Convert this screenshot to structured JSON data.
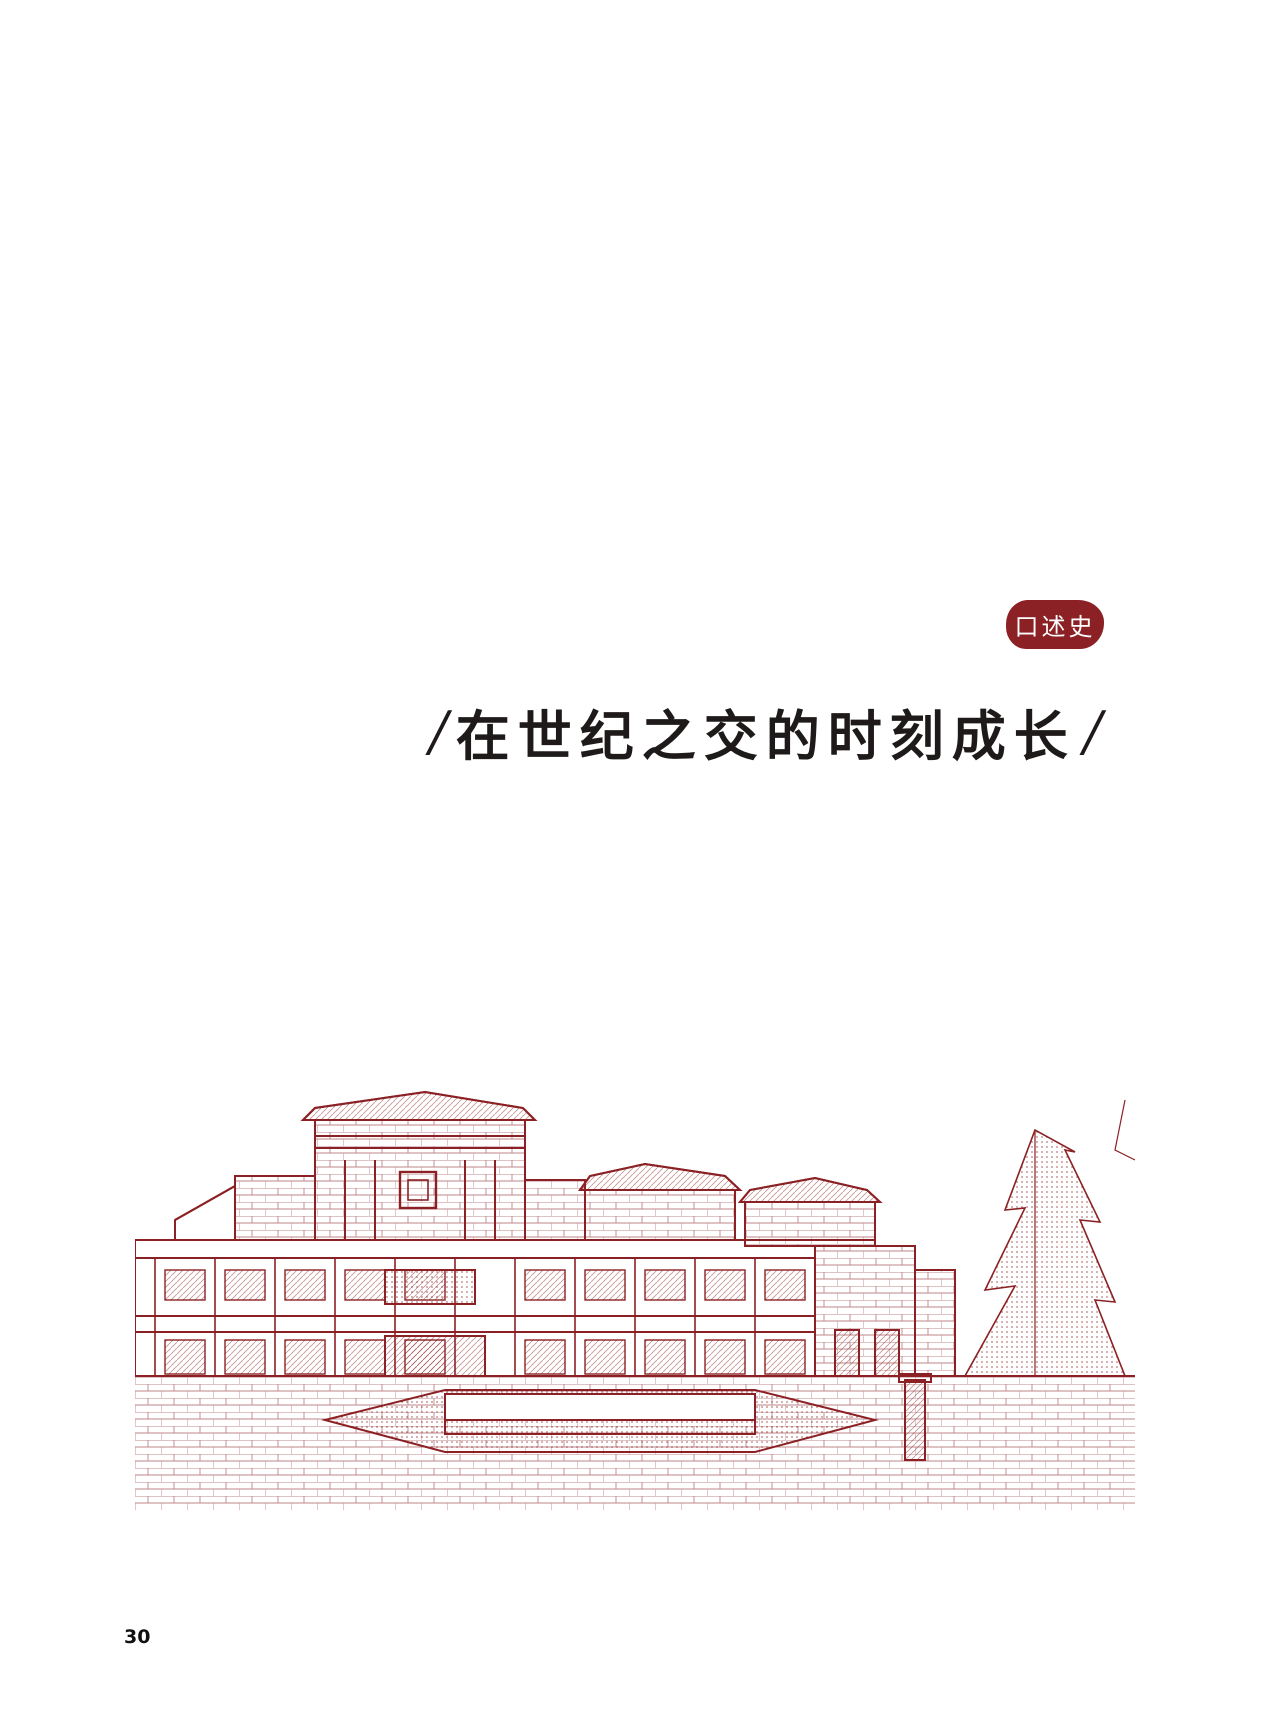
{
  "section_badge": {
    "label": "口述史"
  },
  "title": {
    "text": "在世纪之交的时刻成长",
    "slash_left": "/",
    "slash_right": "/"
  },
  "illustration": {
    "subject": "building-sketch-icon",
    "color": "#8b2124"
  },
  "page_number": "30"
}
